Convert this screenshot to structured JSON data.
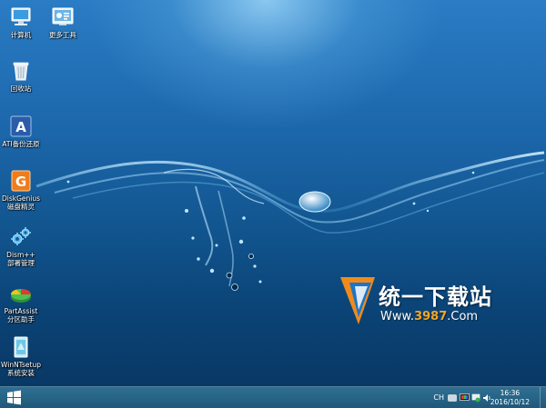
{
  "desktop": {
    "icons": [
      {
        "label_line1": "计算机",
        "label_line2": "",
        "icon": "computer-icon"
      },
      {
        "label_line1": "更多工具",
        "label_line2": "",
        "icon": "tools-icon"
      },
      {
        "label_line1": "回收站",
        "label_line2": "",
        "icon": "recycle-bin-icon"
      },
      {
        "label_line1": "ATI备份还原",
        "label_line2": "",
        "icon": "ati-backup-icon"
      },
      {
        "label_line1": "DiskGenius",
        "label_line2": "磁盘精灵",
        "icon": "diskgenius-icon"
      },
      {
        "label_line1": "Dism++",
        "label_line2": "部署管理",
        "icon": "dism-gear-icon"
      },
      {
        "label_line1": "PartAssist",
        "label_line2": "分区助手",
        "icon": "partassist-icon"
      },
      {
        "label_line1": "WinNTsetup",
        "label_line2": "系统安装",
        "icon": "winntsetup-icon"
      }
    ]
  },
  "watermark": {
    "title": "统一下载站",
    "url_prefix": "Www.",
    "url_number": "3987",
    "url_suffix": ".Com"
  },
  "taskbar": {
    "start_icon": "windows-logo-icon",
    "tray": {
      "lang": "CH",
      "time": "16:36",
      "date": "2016/10/12"
    }
  },
  "colors": {
    "taskbar": "#2a6688",
    "desktop_top": "#2a7cc4",
    "desktop_bottom": "#083560",
    "watermark_number": "#f5a623"
  }
}
